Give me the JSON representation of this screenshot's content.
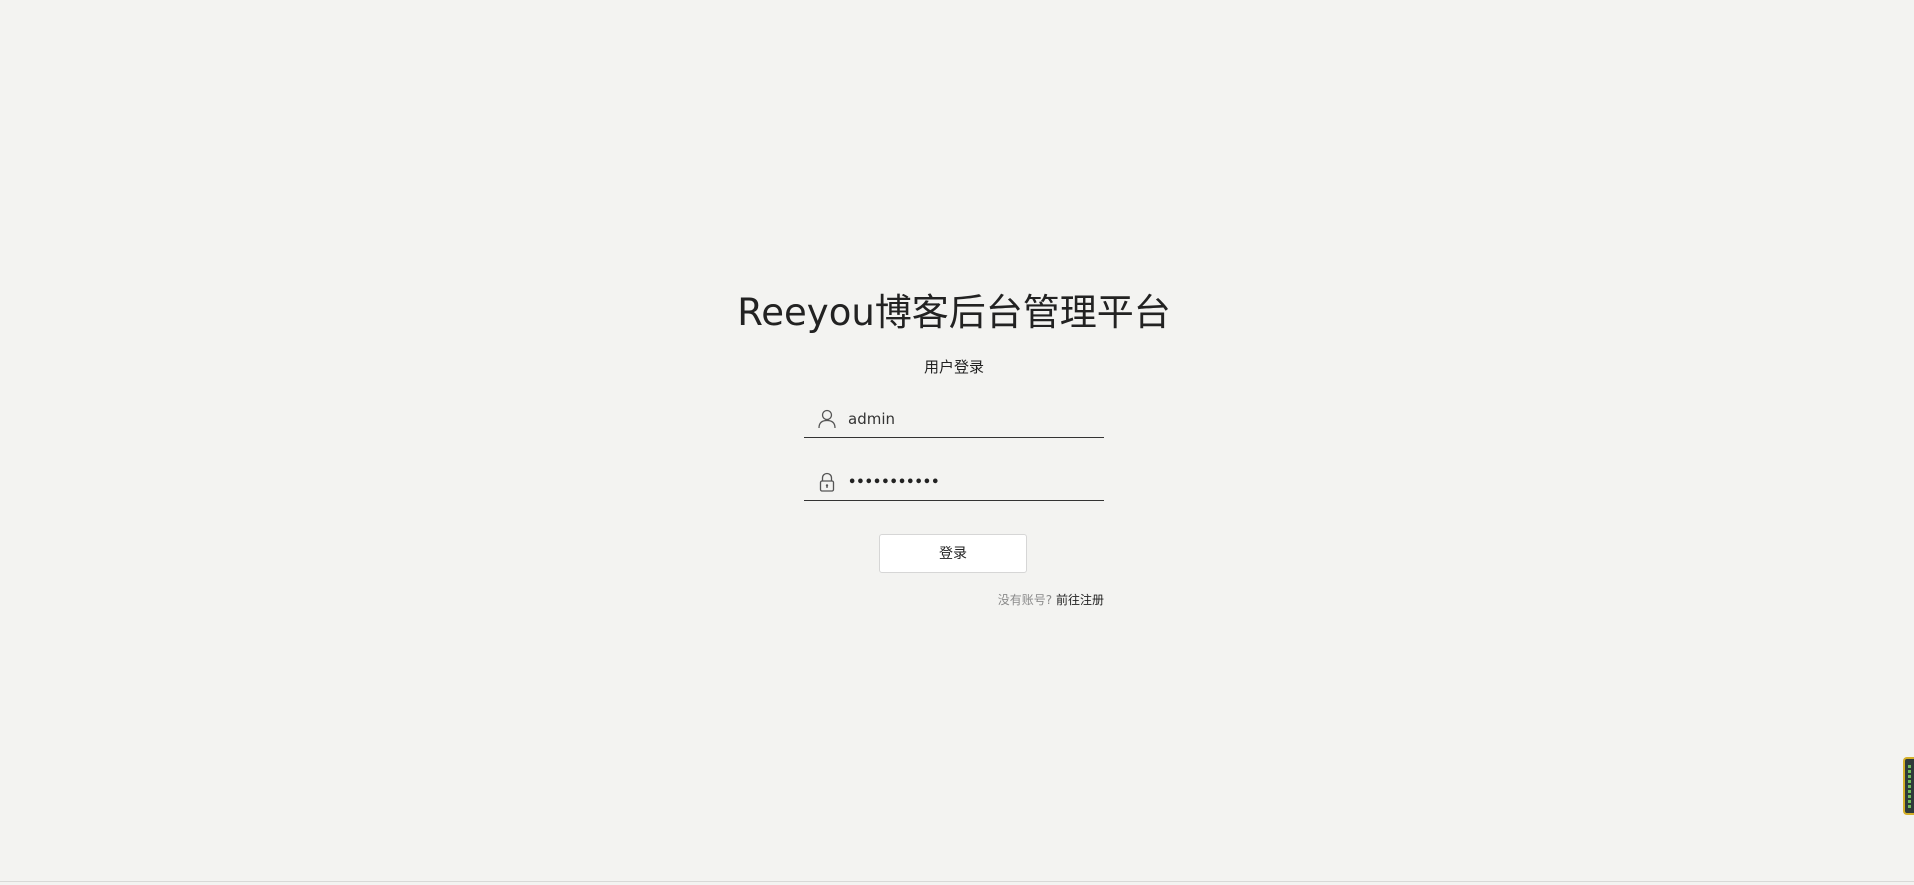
{
  "page": {
    "title": "Reeyou博客后台管理平台",
    "subtitle": "用户登录"
  },
  "form": {
    "username": {
      "value": "admin",
      "icon": "user-icon"
    },
    "password": {
      "value": "•••••••••••",
      "icon": "lock-icon"
    },
    "login_label": "登录",
    "register_prompt": "没有账号?",
    "register_link": "前往注册"
  },
  "colors": {
    "background": "#f3f3f1",
    "text": "#222222",
    "muted": "#8a8a8a",
    "underline": "#333333"
  },
  "side_widget": {
    "icon": "floating-widget-icon"
  }
}
